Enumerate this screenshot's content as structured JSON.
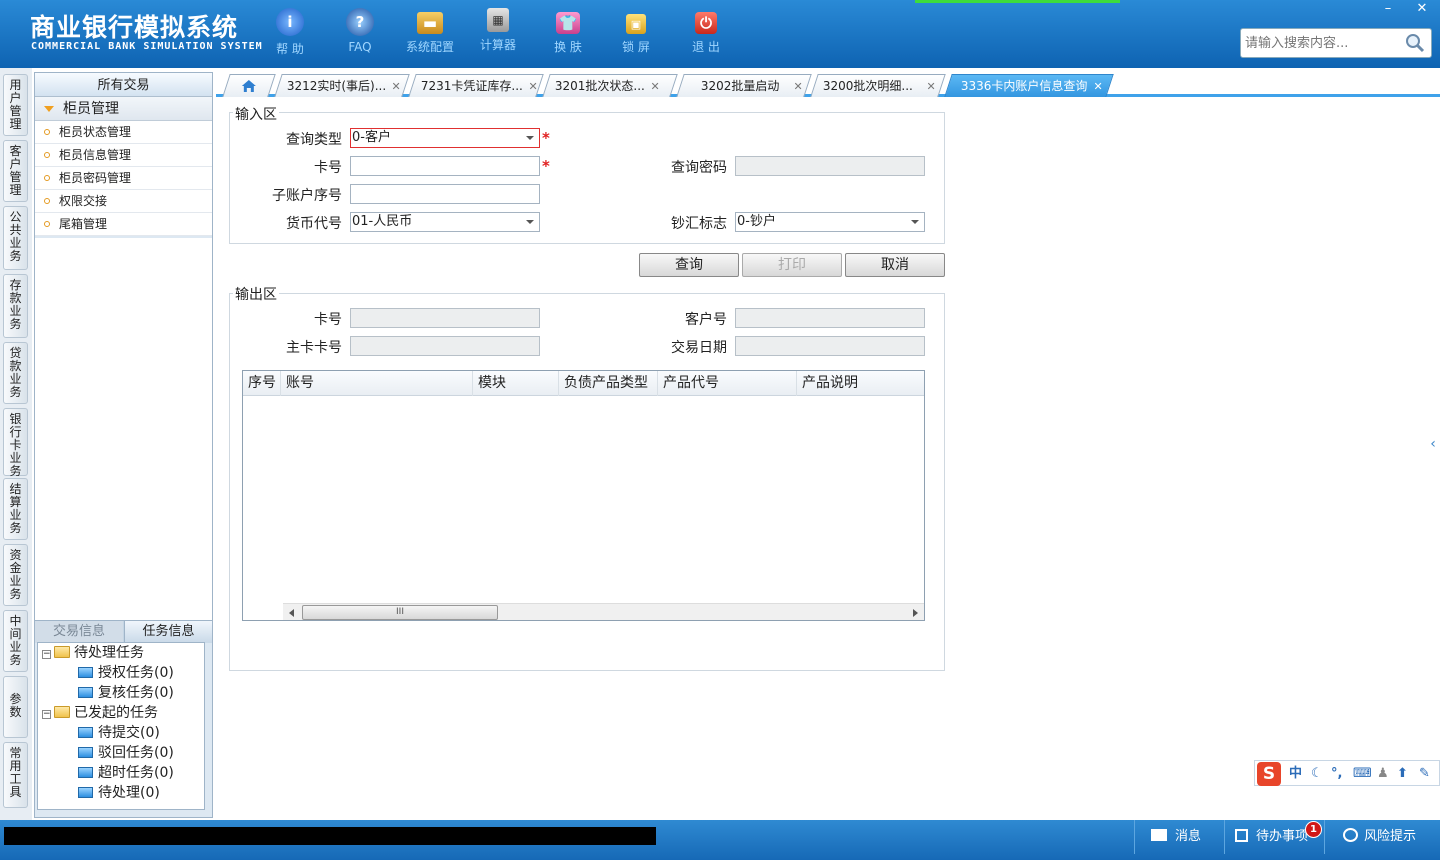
{
  "header": {
    "title": "商业银行模拟系统",
    "subtitle": "COMMERCIAL BANK SIMULATION SYSTEM",
    "buttons": [
      {
        "label": "帮 助",
        "icon": "info-icon"
      },
      {
        "label": "FAQ",
        "icon": "question-icon"
      },
      {
        "label": "系统配置",
        "icon": "toolbox-icon"
      },
      {
        "label": "计算器",
        "icon": "calculator-icon"
      },
      {
        "label": "换 肤",
        "icon": "shirt-icon"
      },
      {
        "label": "锁 屏",
        "icon": "lock-icon"
      },
      {
        "label": "退 出",
        "icon": "power-icon"
      }
    ],
    "search_placeholder": "请输入搜索内容..."
  },
  "vnav": [
    "用户管理",
    "客户管理",
    "公共业务",
    "存款业务",
    "贷款业务",
    "银行卡业务",
    "结算业务",
    "资金业务",
    "中间业务",
    "参数",
    "常用工具"
  ],
  "side": {
    "title": "所有交易",
    "group": "柜员管理",
    "items": [
      "柜员状态管理",
      "柜员信息管理",
      "柜员密码管理",
      "权限交接",
      "尾箱管理"
    ],
    "task_tabs": [
      "交易信息",
      "任务信息"
    ],
    "tree": {
      "pending": "待处理任务",
      "auth": "授权任务(0)",
      "review": "复核任务(0)",
      "initiated": "已发起的任务",
      "to_submit": "待提交(0)",
      "rejected": "驳回任务(0)",
      "timeout": "超时任务(0)",
      "to_process": "待处理(0)"
    }
  },
  "tabs": [
    "3212实时(事后)...",
    "7231卡凭证库存...",
    "3201批次状态...",
    "3202批量启动",
    "3200批次明细...",
    "3336卡内账户信息查询"
  ],
  "form": {
    "input_legend": "输入区",
    "query_type_label": "查询类型",
    "query_type_value": "0-客户",
    "card_label": "卡号",
    "password_label": "查询密码",
    "subaccount_label": "子账户序号",
    "currency_label": "货币代号",
    "currency_value": "01-人民币",
    "cash_flag_label": "钞汇标志",
    "cash_flag_value": "0-钞户",
    "query_btn": "查询",
    "print_btn": "打印",
    "cancel_btn": "取消",
    "required_mark": "*"
  },
  "output": {
    "legend": "输出区",
    "card_label": "卡号",
    "customer_label": "客户号",
    "main_card_label": "主卡卡号",
    "date_label": "交易日期",
    "columns": [
      "序号",
      "账号",
      "模块",
      "负债产品类型",
      "产品代号",
      "产品说明"
    ]
  },
  "ime": {
    "logo": "S",
    "lang": "中"
  },
  "status": {
    "message": "消息",
    "todo": "待办事项",
    "todo_count": "1",
    "risk": "风险提示"
  },
  "colors": {
    "accent": "#1669b6",
    "active_tab": "#3396e0",
    "required": "#e02020"
  }
}
